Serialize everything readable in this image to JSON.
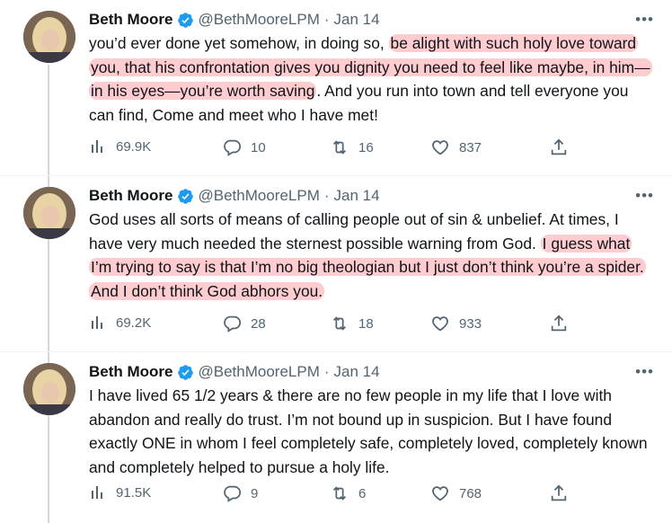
{
  "tweets": [
    {
      "author": "Beth Moore",
      "handle": "@BethMooreLPM",
      "date": "Jan 14",
      "text_before": "you’d ever done yet somehow, in doing so, ",
      "text_highlight": "be alight with such holy love toward you, that his confrontation gives you dignity you need to feel like maybe, in him—in his eyes—you’re worth saving",
      "text_after": ". And you run into town and tell everyone you can find, Come and meet who I have met!",
      "views": "69.9K",
      "replies": "10",
      "retweets": "16",
      "likes": "837"
    },
    {
      "author": "Beth Moore",
      "handle": "@BethMooreLPM",
      "date": "Jan 14",
      "text_before": "God uses all sorts of means of calling people out of sin & unbelief. At times, I have very much needed the sternest possible warning from God. ",
      "text_highlight": "I guess what I’m trying to say is that I’m no big theologian but I just don’t think you’re a spider. And I don’t think God abhors you.",
      "text_after": "",
      "views": "69.2K",
      "replies": "28",
      "retweets": "18",
      "likes": "933"
    },
    {
      "author": "Beth Moore",
      "handle": "@BethMooreLPM",
      "date": "Jan 14",
      "text_before": "I have lived 65 1/2 years & there are no few people in my life that I love with abandon and really do trust. I’m not bound up in suspicion. But I have found exactly ONE in whom I feel completely safe, completely loved, completely known and completely helped to pursue a holy life.",
      "text_highlight": "",
      "text_after": "",
      "views": "91.5K",
      "replies": "9",
      "retweets": "6",
      "likes": "768"
    }
  ],
  "more_label": "•••",
  "dot": "·",
  "colors": {
    "highlight": "#ff7882",
    "verified": "#1d9bf0",
    "muted": "#536471"
  }
}
